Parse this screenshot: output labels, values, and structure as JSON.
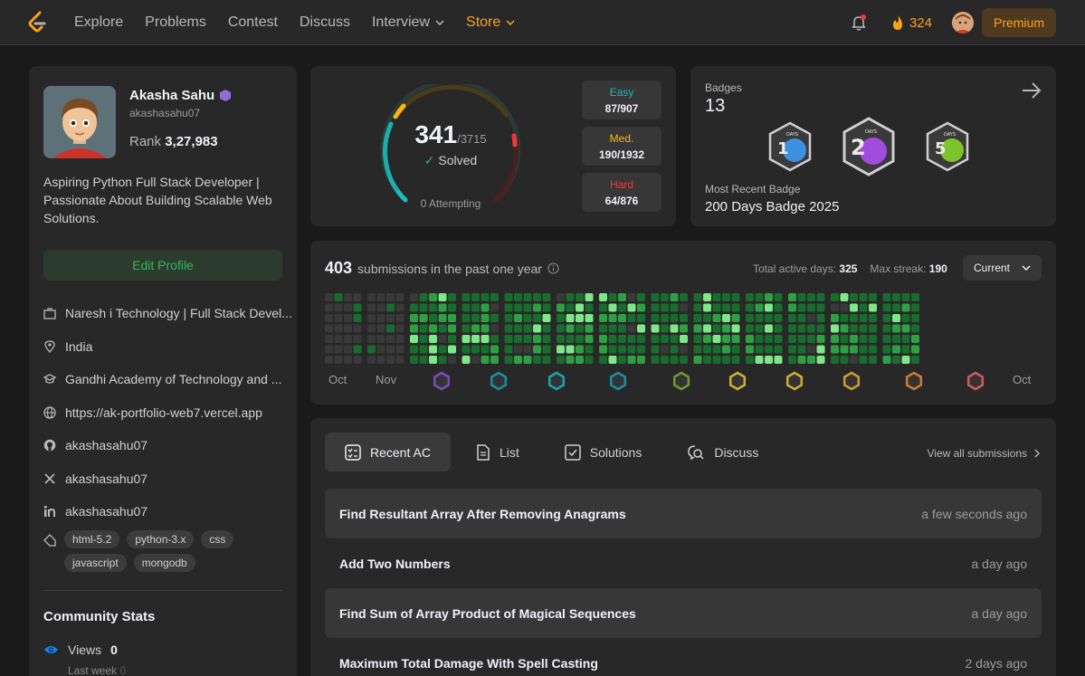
{
  "nav": {
    "links": [
      "Explore",
      "Problems",
      "Contest",
      "Discuss",
      "Interview",
      "Store"
    ],
    "streak": "324",
    "premium_label": "Premium"
  },
  "profile": {
    "name": "Akasha Sahu",
    "handle": "akashasahu07",
    "rank_label": "Rank",
    "rank_value": "3,27,983",
    "bio": "Aspiring Python Full Stack Developer | Passionate About Building Scalable Web Solutions.",
    "edit_label": "Edit Profile",
    "company": "Naresh i Technology | Full Stack Devel...",
    "location": "India",
    "school": "Gandhi Academy of Technology and ...",
    "website": "https://ak-portfolio-web7.vercel.app",
    "github": "akashasahu07",
    "twitter": "akashasahu07",
    "linkedin": "akashasahu07",
    "tags": [
      "html-5.2",
      "python-3.x",
      "css",
      "javascript",
      "mongodb"
    ]
  },
  "community": {
    "title": "Community Stats",
    "views_label": "Views",
    "views_value": "0",
    "last_week_label": "Last week",
    "last_week_value": "0"
  },
  "solved": {
    "count": "341",
    "total": "/3715",
    "solved_label": "Solved",
    "attempting": "0 Attempting",
    "easy_label": "Easy",
    "easy_value": "87/907",
    "med_label": "Med.",
    "med_value": "190/1932",
    "hard_label": "Hard",
    "hard_value": "64/876",
    "colors": {
      "easy": "#1cbaba",
      "medium": "#ffb700",
      "hard": "#f63737"
    }
  },
  "badges": {
    "label": "Badges",
    "count": "13",
    "icons": [
      "100-days-badge-icon",
      "200-days-badge-icon",
      "50-days-badge-icon"
    ],
    "recent_label": "Most Recent Badge",
    "recent_value": "200 Days Badge 2025"
  },
  "calendar": {
    "count": "403",
    "text": "submissions in the past one year",
    "active_days_label": "Total active days:",
    "active_days_value": "325",
    "max_streak_label": "Max streak:",
    "max_streak_value": "190",
    "select_value": "Current",
    "months": [
      "Oct",
      "Nov",
      "Oct"
    ]
  },
  "submissions": {
    "tabs": [
      "Recent AC",
      "List",
      "Solutions",
      "Discuss"
    ],
    "view_all": "View all submissions",
    "rows": [
      {
        "title": "Find Resultant Array After Removing Anagrams",
        "time": "a few seconds ago"
      },
      {
        "title": "Add Two Numbers",
        "time": "a day ago"
      },
      {
        "title": "Find Sum of Array Product of Magical Sequences",
        "time": "a day ago"
      },
      {
        "title": "Maximum Total Damage With Spell Casting",
        "time": "2 days ago"
      }
    ]
  }
}
